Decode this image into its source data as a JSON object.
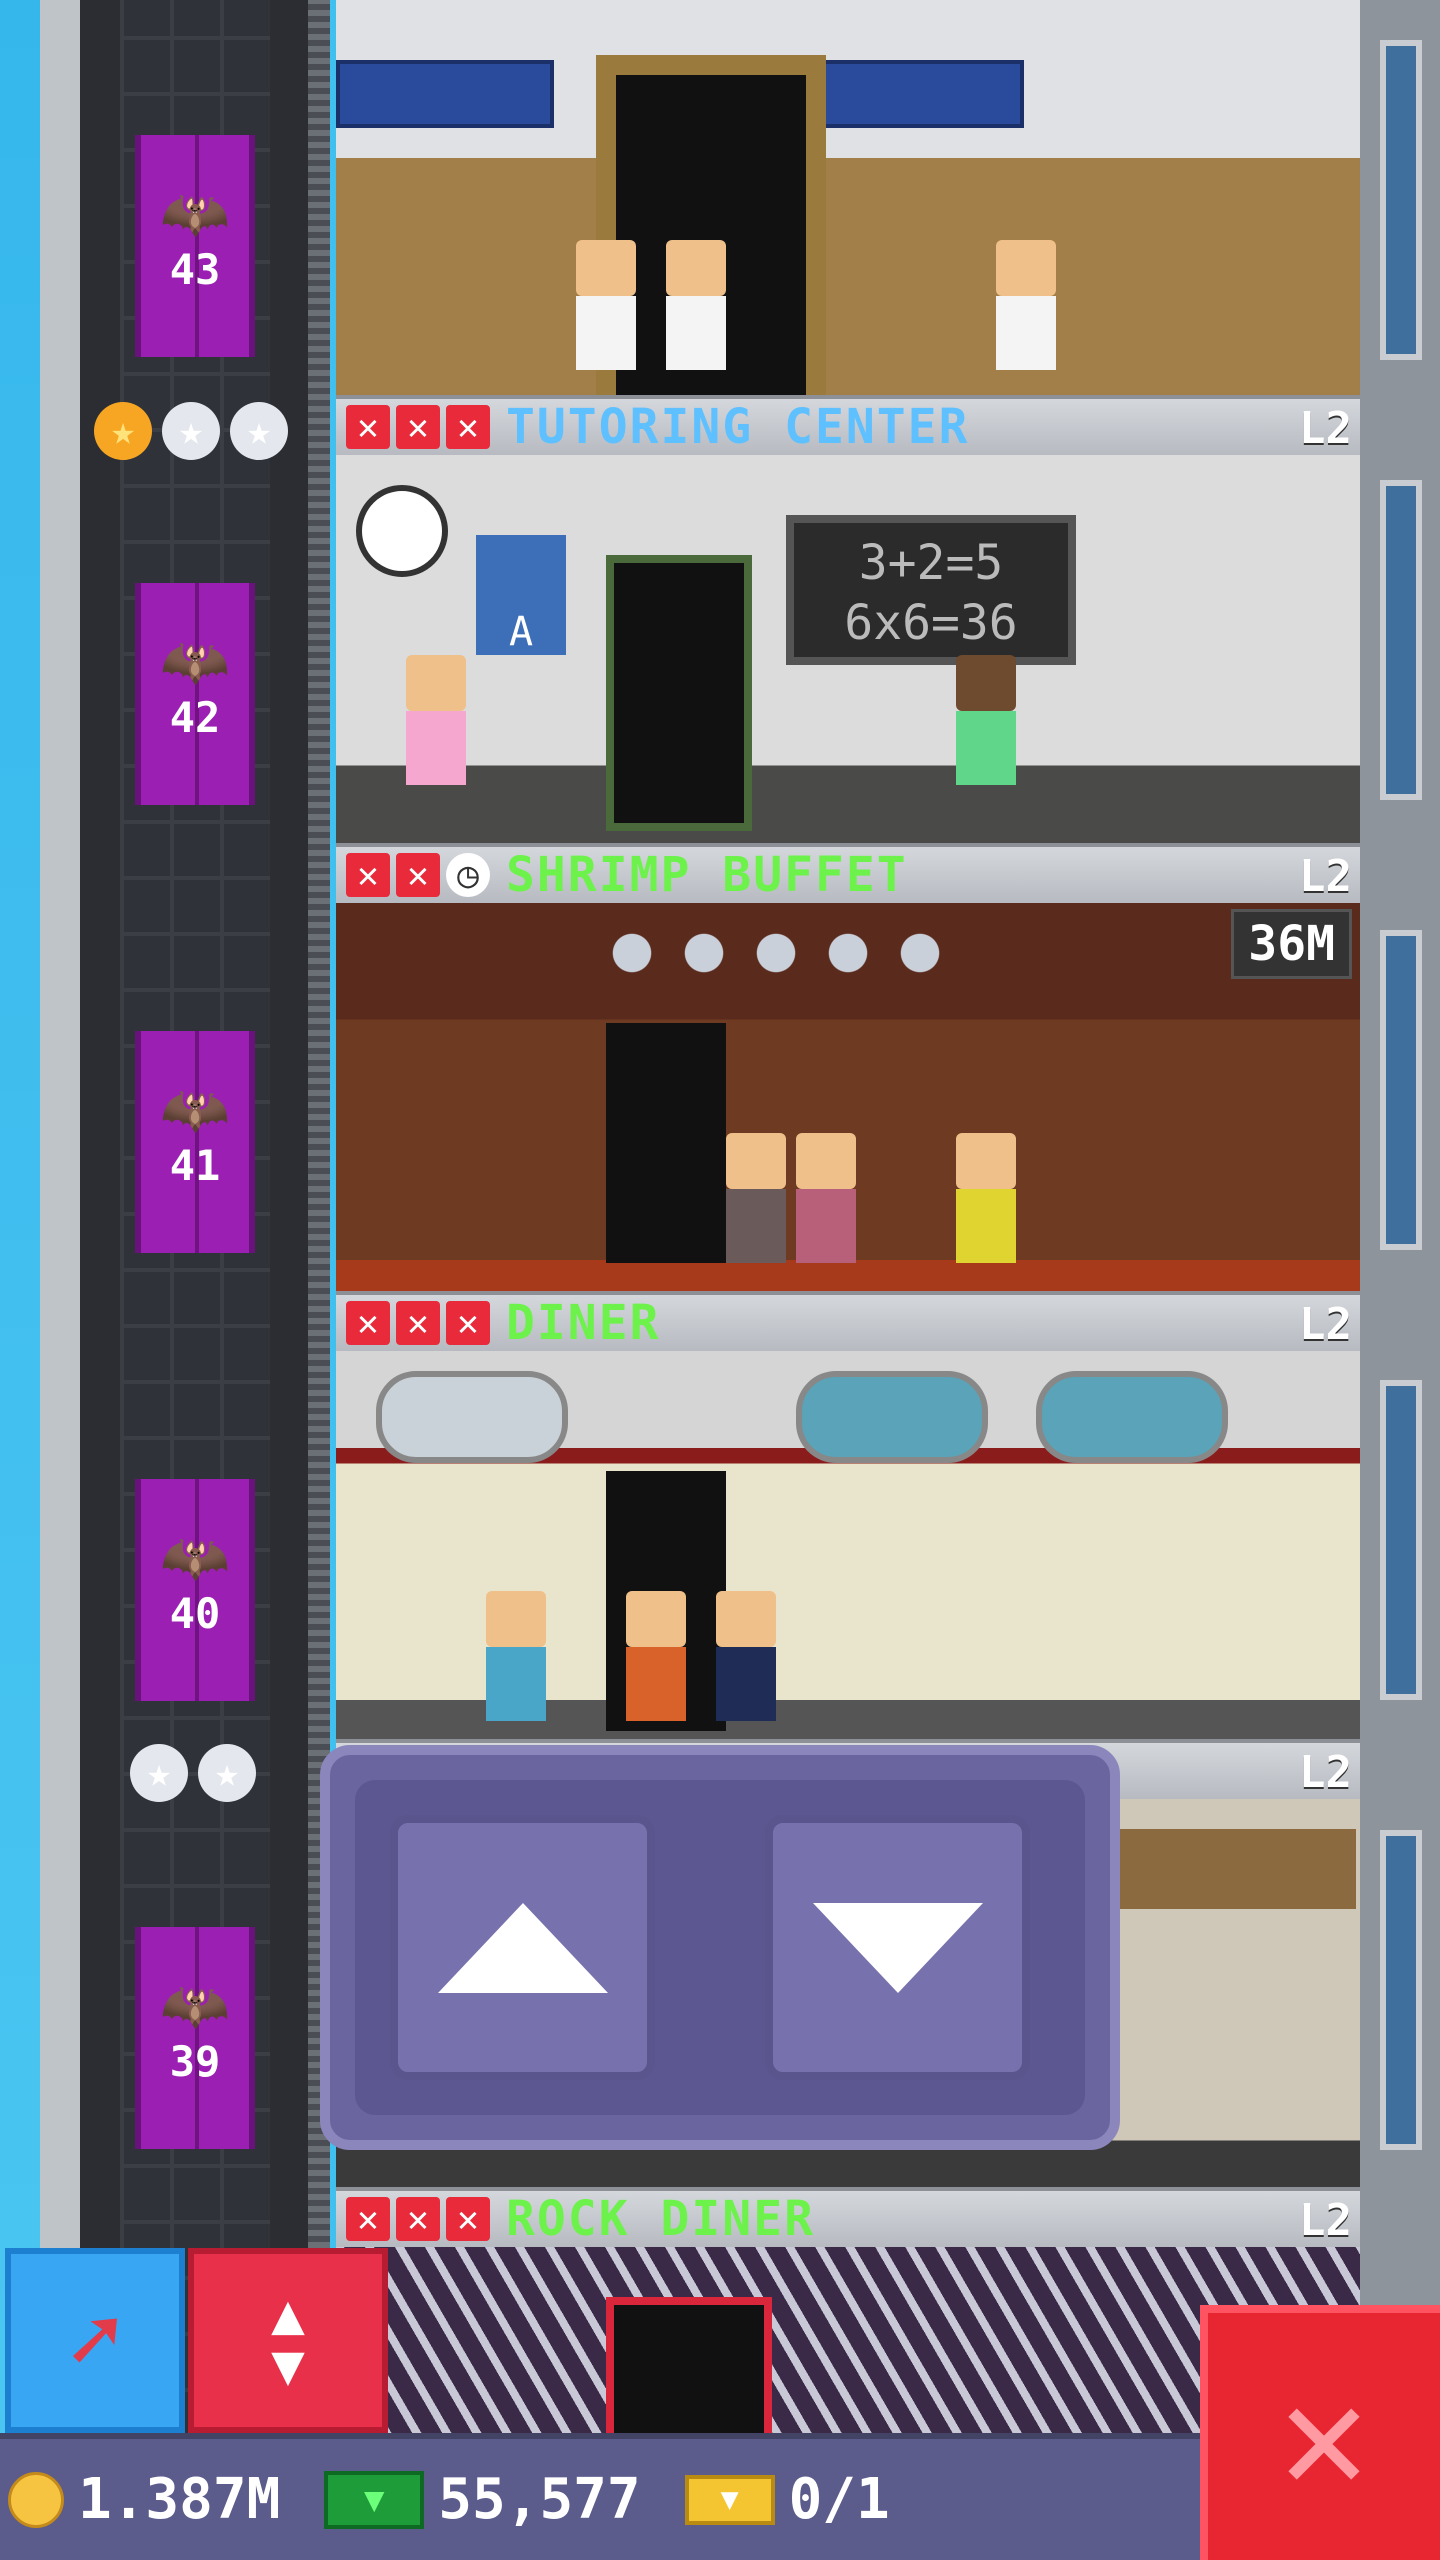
{
  "floors": [
    {
      "number": "43",
      "name": "",
      "level": "",
      "color": "#5fc0ff"
    },
    {
      "number": "42",
      "name": "TUTORING CENTER",
      "level": "L2",
      "color": "#5fc0ff",
      "marks": [
        "x",
        "x",
        "x"
      ]
    },
    {
      "number": "41",
      "name": "SHRIMP BUFFET",
      "level": "L2",
      "color": "#6df24b",
      "marks": [
        "x",
        "x",
        "clock"
      ],
      "timer": "36M"
    },
    {
      "number": "40",
      "name": "DINER",
      "level": "L2",
      "color": "#6df24b",
      "marks": [
        "x",
        "x",
        "x"
      ]
    },
    {
      "number": "39",
      "name": "",
      "level": "L2",
      "color": "#6df24b"
    },
    {
      "number": "",
      "name": "ROCK DINER",
      "level": "L2",
      "color": "#6df24b",
      "marks": [
        "x",
        "x",
        "x"
      ]
    }
  ],
  "chalkboard": {
    "line1": "3+2=5",
    "line2": "6x6=36"
  },
  "poster_letter": "A",
  "elevator_controls": {
    "up_icon": "arrow-up-icon",
    "down_icon": "arrow-down-icon"
  },
  "tools": {
    "left_icon": "arrow-icon",
    "right_icon": "up-down-icon",
    "close_icon": "close-icon"
  },
  "status": {
    "coins": "1.387M",
    "bux": "55,577",
    "tickets": "0/1"
  }
}
